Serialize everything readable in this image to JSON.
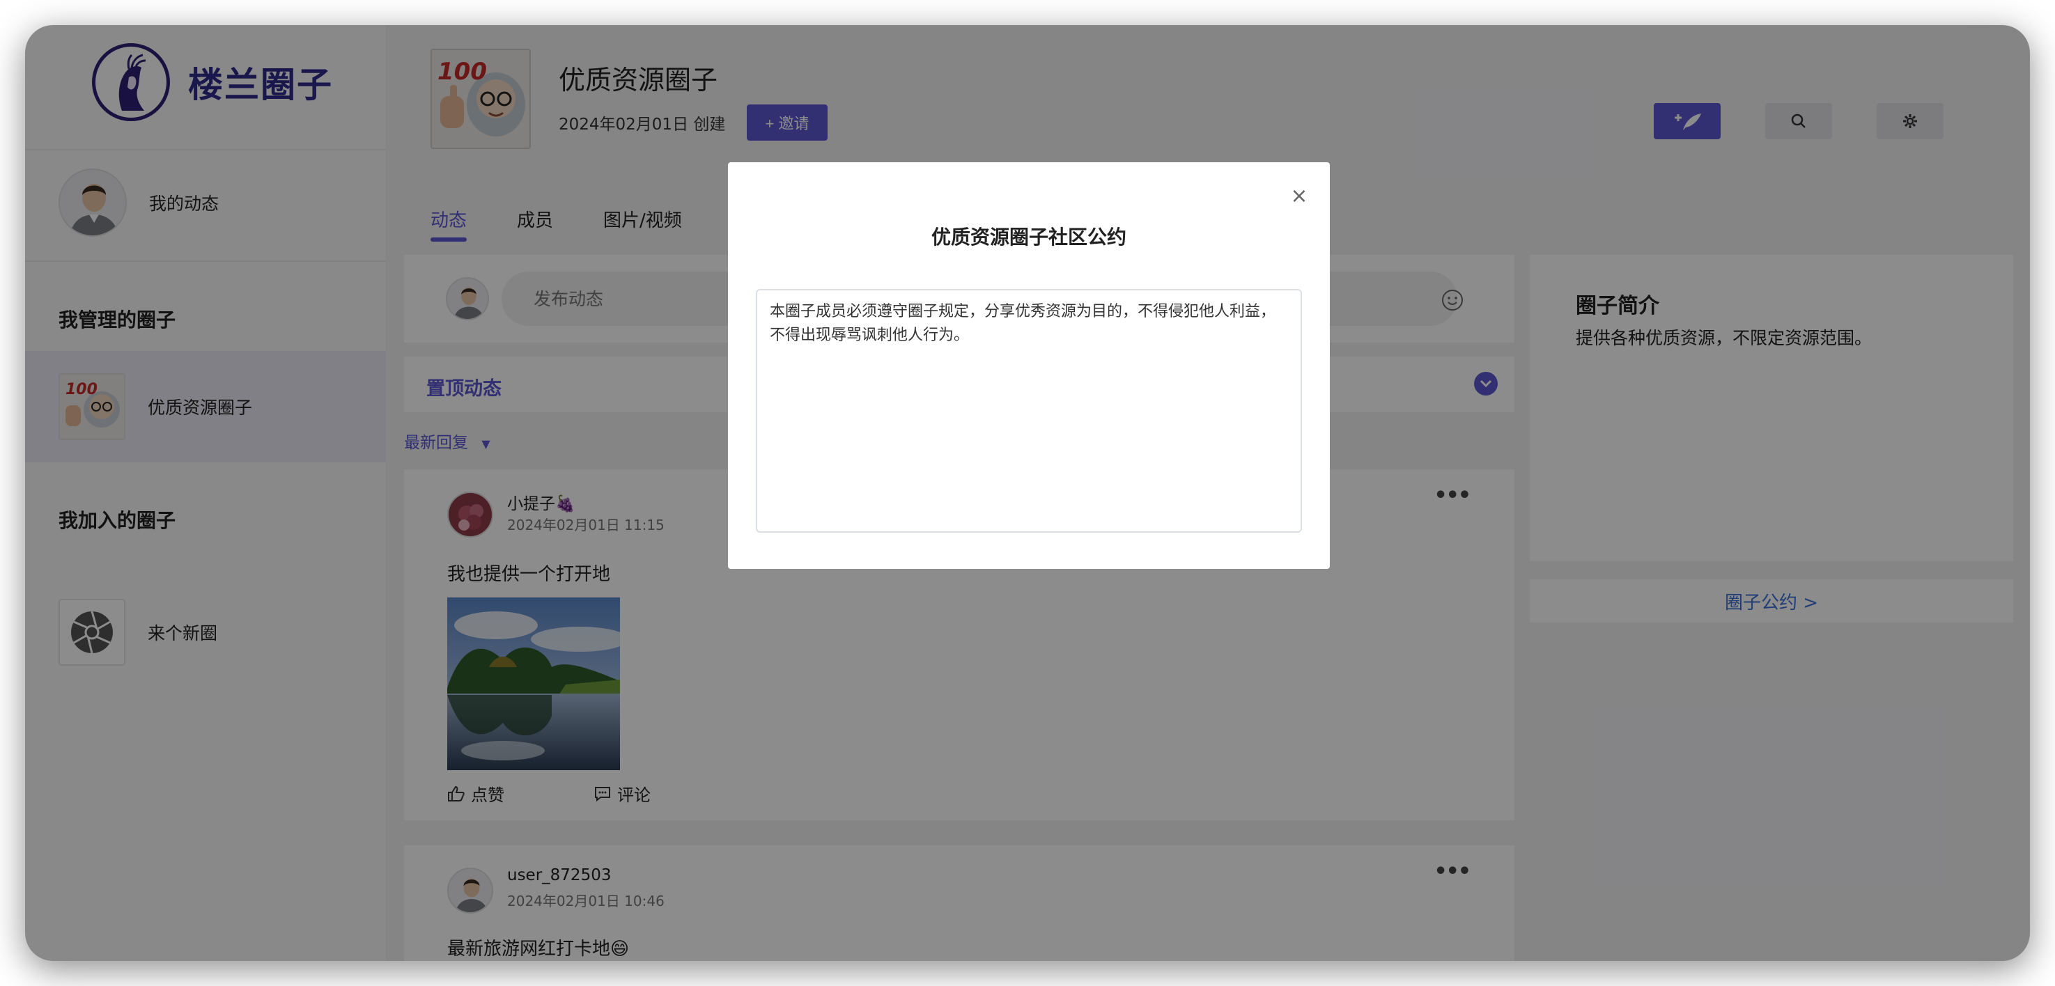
{
  "sidebar": {
    "brand": "楼兰圈子",
    "my_feed": "我的动态",
    "managed_heading": "我管理的圈子",
    "managed_items": [
      {
        "label": "优质资源圈子"
      }
    ],
    "joined_heading": "我加入的圈子",
    "joined_items": [
      {
        "label": "来个新圈"
      }
    ]
  },
  "circle": {
    "title": "优质资源圈子",
    "created": "2024年02月01日 创建",
    "invite_label": "+ 邀请",
    "thumb_badge": "100"
  },
  "header_buttons": [
    {
      "icon": "compose-icon"
    },
    {
      "icon": "search-icon"
    },
    {
      "icon": "gear-icon"
    }
  ],
  "tabs": [
    {
      "label": "动态",
      "active": true
    },
    {
      "label": "成员",
      "active": false
    },
    {
      "label": "图片/视频",
      "active": false
    }
  ],
  "composer": {
    "placeholder": "发布动态"
  },
  "pinned": {
    "label": "置顶动态"
  },
  "sort": {
    "label": "最新回复"
  },
  "posts": [
    {
      "user": "小提子🍇",
      "time": "2024年02月01日 11:15",
      "text": "我也提供一个打开地",
      "like_label": "点赞",
      "comment_label": "评论"
    },
    {
      "user": "user_872503",
      "time": "2024年02月01日 10:46",
      "text": "最新旅游网红打卡地😄"
    }
  ],
  "intro": {
    "title": "圈子简介",
    "text": "提供各种优质资源，不限定资源范围。"
  },
  "rules_link": "圈子公约 >",
  "modal": {
    "title": "优质资源圈子社区公约",
    "body": "本圈子成员必须遵守圈子规定，分享优秀资源为目的，不得侵犯他人利益，不得出现辱骂讽刺他人行为。",
    "close": "×"
  },
  "colors": {
    "accent": "#5b57d1",
    "link": "#3b6fd4",
    "brand": "#2e2a8a"
  }
}
